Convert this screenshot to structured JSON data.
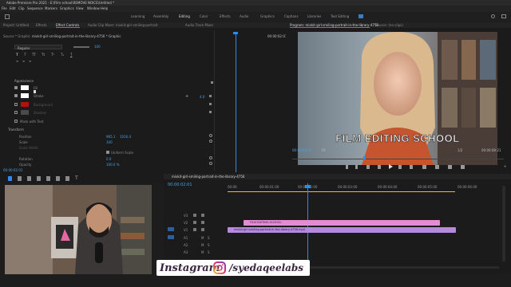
{
  "window": {
    "title": "Adobe Premiere Pro 2021 - E:\\Film school\\REMOVE NOICE\\Untitled *"
  },
  "menu": [
    "File",
    "Edit",
    "Clip",
    "Sequence",
    "Markers",
    "Graphics",
    "View",
    "Window",
    "Help"
  ],
  "workspaces": [
    "Learning",
    "Assembly",
    "Editing",
    "Color",
    "Effects",
    "Audio",
    "Graphics",
    "Captions",
    "Libraries",
    "Text Editing"
  ],
  "left_panel": {
    "tabs": [
      "Project: Untitled",
      "Effects",
      "Effect Controls",
      "Audio Clip Mixer: mixkit-girl-smiling-portrait",
      "Audio Track Mixer"
    ],
    "source_label": "Source * Graphic",
    "clip_label": "mixkit-girl-smiling-portrait-in-the-library-4756 * Graphic",
    "font_style": "Regular",
    "font_size": "100",
    "appearance_heading": "Appearance",
    "appearance_rows": [
      {
        "label": "Fill",
        "checked": true,
        "color": "#ffffff"
      },
      {
        "label": "Stroke",
        "checked": true,
        "color": "#ffffff",
        "value": "4.0"
      },
      {
        "label": "Background",
        "checked": false,
        "color": "#b31010"
      },
      {
        "label": "Shadow",
        "checked": false,
        "color": "#4a4a4a"
      }
    ],
    "mask_text": "Mask with Text",
    "transform_heading": "Transform",
    "position_label": "Position",
    "position_values": [
      "965.1",
      "1016.4"
    ],
    "scale_label": "Scale",
    "scale_value": "100",
    "scale_width_label": "Scale Width",
    "uniform_scale": "Uniform Scale",
    "rotation_label": "Rotation",
    "rotation_value": "0.0",
    "opacity_label": "Opacity",
    "opacity_value": "100.0 %",
    "timecode": "00:00:02:01",
    "ec_timecode": "00:00:02:01"
  },
  "program": {
    "tab": "Program: mixkit-girl-smiling-portrait-in-the-library-4756",
    "tab2": "Source: (no clips)",
    "overlay_text": "FILM EDITING SCHOOL",
    "timecode_left": "00:00:02:01",
    "fit": "Fit",
    "quality": "1/2",
    "timecode_right": "00:00:08:21"
  },
  "timeline": {
    "sequence_tab": "mixkit-girl-smiling-portrait-in-the-library-4756",
    "timecode": "00:00:02:01",
    "ruler": [
      "00:00",
      "00:00:01:00",
      "00:00:02:00",
      "00:00:03:00",
      "00:00:04:00",
      "00:00:05:00",
      "00:00:06:00"
    ],
    "tracks": [
      "V3",
      "V2",
      "V1",
      "A1",
      "A2",
      "A3"
    ],
    "graphic_clip": "FILM EDITING SCHOOL",
    "video_clip": "mixkit-girl-smiling-portrait-in-the-library-4756.mp4"
  },
  "watermark": {
    "instagram": "Instagram",
    "handle": "/syedaqeelabs"
  },
  "colors": {
    "accent_blue": "#2d8ceb",
    "graphic_clip": "#e48bd6",
    "video_clip": "#b589dd"
  }
}
